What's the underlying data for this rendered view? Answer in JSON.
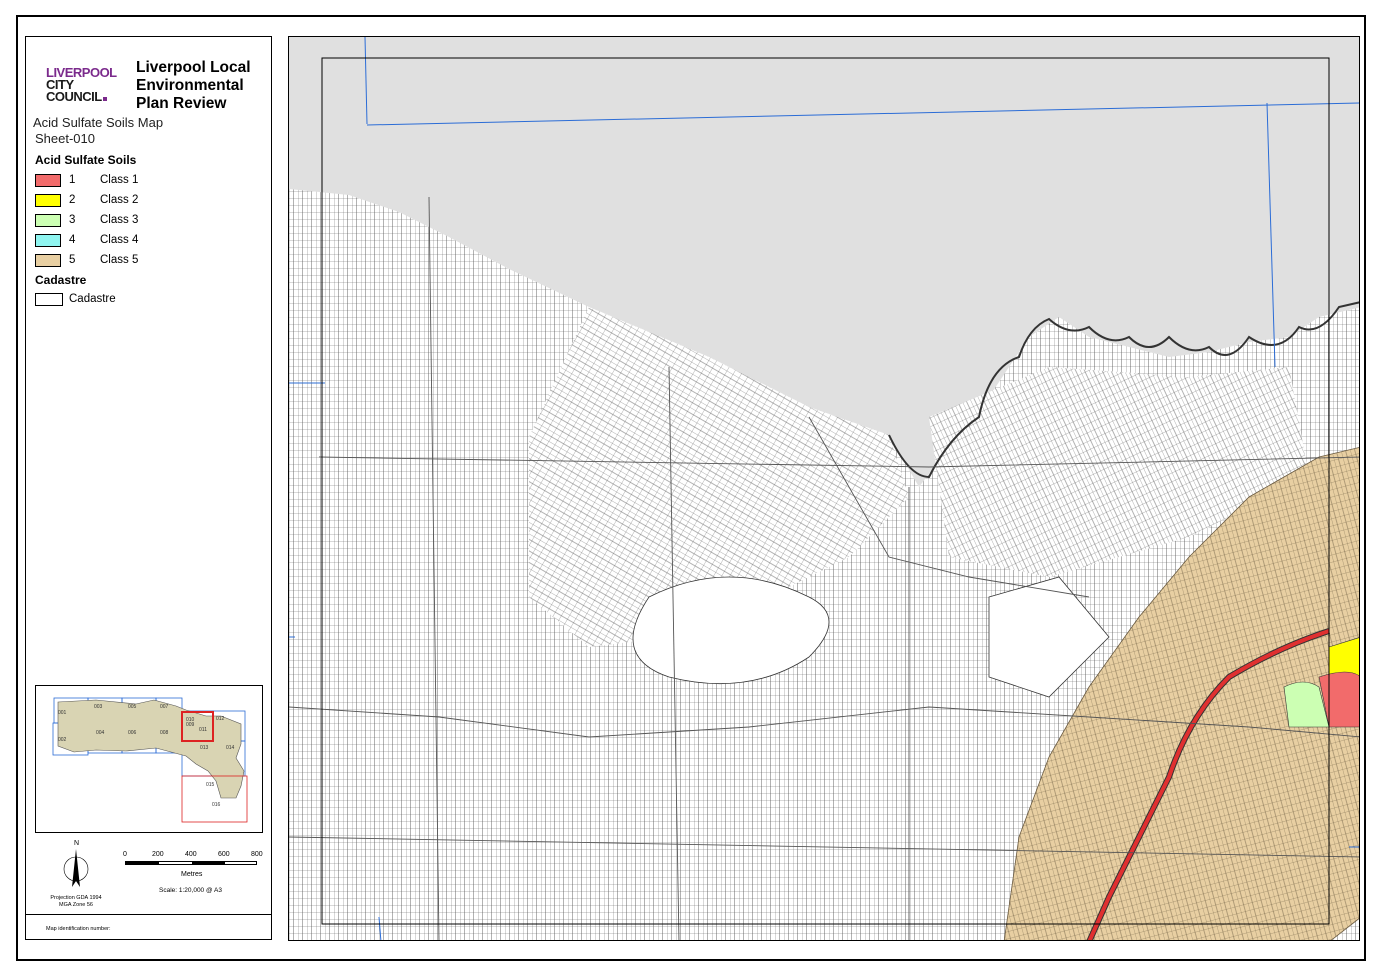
{
  "header": {
    "logo_line1": "LIVERPOOL",
    "logo_line2": "CITY",
    "logo_line3": "COUNCIL",
    "title": "Liverpool Local Environmental Plan Review",
    "subtitle": "Acid Sulfate Soils Map",
    "sheet": "Sheet-010"
  },
  "legend": {
    "heading": "Acid Sulfate Soils",
    "items": [
      {
        "code": "1",
        "label": "Class 1",
        "color": "#f26b6b"
      },
      {
        "code": "2",
        "label": "Class 2",
        "color": "#ffff00"
      },
      {
        "code": "3",
        "label": "Class 3",
        "color": "#ccffb3"
      },
      {
        "code": "4",
        "label": "Class 4",
        "color": "#8ff5f0"
      },
      {
        "code": "5",
        "label": "Class 5",
        "color": "#e8cfa2"
      }
    ],
    "cadastre_heading": "Cadastre",
    "cadastre_label": "Cadastre"
  },
  "index_map": {
    "sheets": [
      "001",
      "002",
      "003",
      "004",
      "005",
      "006",
      "007",
      "008",
      "009",
      "010",
      "011",
      "012",
      "013",
      "014",
      "015",
      "016"
    ]
  },
  "north_label": "N",
  "scalebar": {
    "ticks": [
      "0",
      "200",
      "400",
      "600",
      "800"
    ],
    "units": "Metres"
  },
  "projection": [
    "Projection GDA 1994",
    "MGA Zone 56"
  ],
  "scale": "Scale: 1:20,000 @ A3",
  "map_id_label": "Map identification number:",
  "colors": {
    "water": "#e0e0e0",
    "boundary_blue": "#2b6cd6",
    "railway_red": "#e03030"
  }
}
